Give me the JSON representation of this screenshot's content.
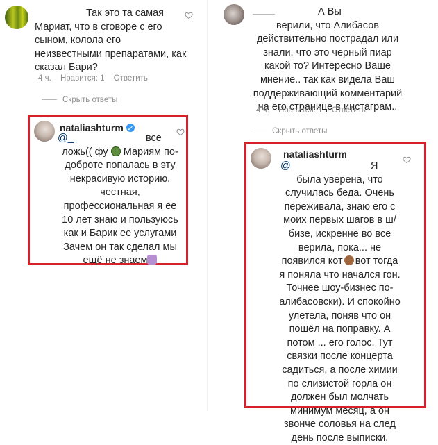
{
  "left": {
    "comment1": {
      "lines": [
        "Так это та самая",
        "Мариат, что в сговоре с его",
        "сыном, колола его",
        "неизвестными препаратами, как",
        "сказал Бари?"
      ],
      "meta": {
        "time": "4 ч.",
        "likes": "Нравится: 1",
        "reply": "Ответить"
      }
    },
    "hide_replies": "Скрыть ответы",
    "reply": {
      "username": "nataliashturm",
      "mention": "@_",
      "lines": [
        "все",
        "ложь(( фу",
        "Мариям по-",
        "доброте попалась в эту",
        "некрасивую историю,",
        "честная,",
        "профессиональная я ее",
        "10 лет знаю и пользуюсь",
        "как и Барик ее услугами",
        "Зачем он так сделал мы",
        "ещё не знаем"
      ]
    }
  },
  "right": {
    "comment1": {
      "lines": [
        "А Вы",
        "верили, что Алибасов",
        "действительно пострадал или",
        "знали, что это черный пиар",
        "какой то? Интересно Ваше",
        "мнение.. так как видела Ваш",
        "поддерживающий комментарий",
        "на его странице в инстаграм.."
      ],
      "meta": {
        "time": "4 ч.",
        "likes": "Нравится: 1",
        "reply": "Ответить"
      }
    },
    "hide_replies": "Скрыть ответы",
    "reply": {
      "username": "nataliashturm",
      "mention": "@",
      "lines": [
        "Я",
        "была уверена, что",
        "случилась беда. Очень",
        "переживала, знаю его с",
        "моих первых шагов в ш/",
        "бизе, искренне во все",
        "верила, пока... не",
        "появился кот",
        "вот тогда",
        "я поняла что начался гон.",
        "Точнее шоу-бизнес по-",
        "алибасовски). И спокойно",
        "улетела, поняв что он",
        "пошёл на поправку. А",
        "потом ... его голос. Тут",
        "связки после концерта",
        "садиться, а после химии",
        "по слизистой горла он",
        "должен был молчать",
        "минимум месяц, а он",
        "звонче соловья на след",
        "день после выписки."
      ]
    }
  },
  "colors": {
    "highlight_border": "#d6202b",
    "verified": "#3897f0",
    "meta_text": "#8e8e8e"
  }
}
